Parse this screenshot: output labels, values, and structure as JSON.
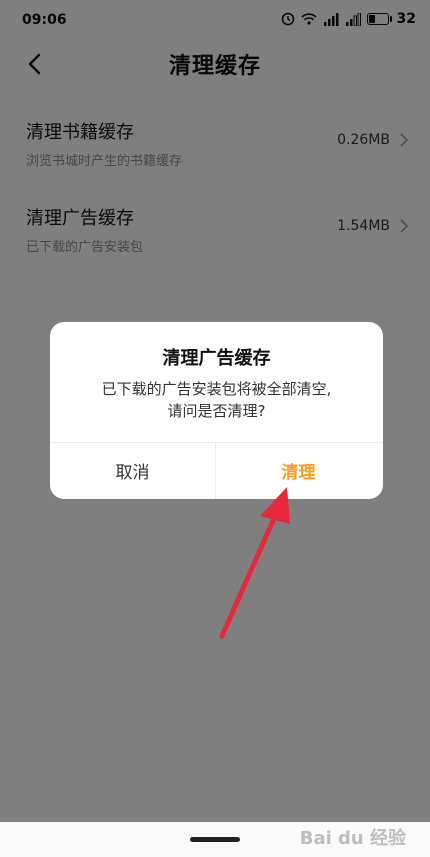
{
  "status_bar": {
    "time": "09:06",
    "battery_level": "32",
    "battery_fraction": 0.32
  },
  "header": {
    "title": "清理缓存"
  },
  "items": [
    {
      "title": "清理书籍缓存",
      "subtitle": "浏览书城时产生的书籍缓存",
      "size": "0.26MB"
    },
    {
      "title": "清理广告缓存",
      "subtitle": "已下载的广告安装包",
      "size": "1.54MB"
    }
  ],
  "dialog": {
    "title": "清理广告缓存",
    "message_line1": "已下载的广告安装包将被全部清空,",
    "message_line2": "请问是否清理?",
    "cancel_label": "取消",
    "confirm_label": "清理"
  },
  "watermark": "Bai du 经验",
  "colors": {
    "accent": "#ff9a1a",
    "annotation_arrow": "#e8283a"
  }
}
